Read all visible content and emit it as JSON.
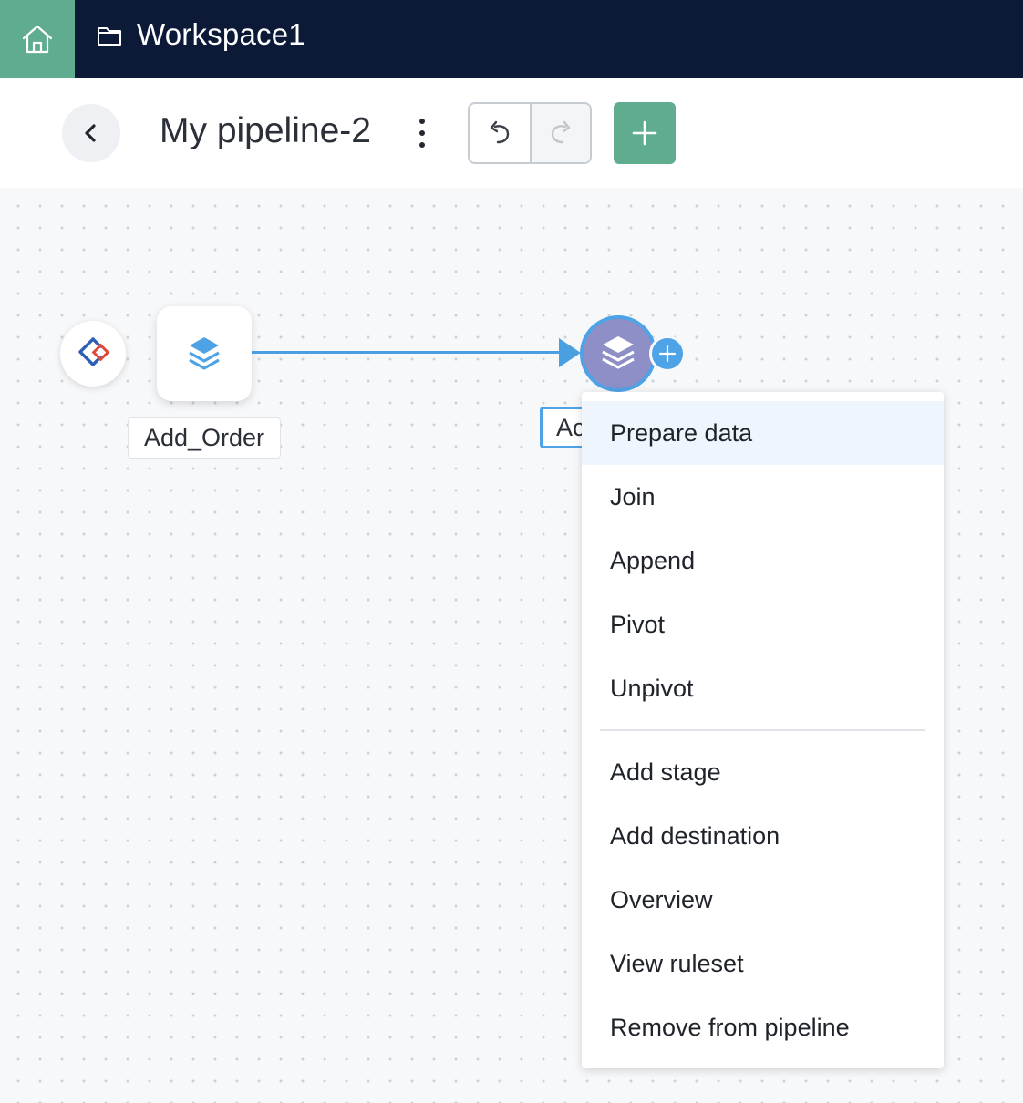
{
  "topbar": {
    "workspace_title": "Workspace1",
    "home_icon": "home-icon",
    "folder_icon": "folder-icon"
  },
  "header": {
    "pipeline_title": "My pipeline-2",
    "back_icon": "chevron-left-icon",
    "more_icon": "kebab-icon",
    "undo_icon": "undo-icon",
    "redo_icon": "redo-icon",
    "add_icon": "plus-icon"
  },
  "canvas": {
    "source_node_icon": "source-connector-icon",
    "order_node_label": "Add_Order",
    "stage_node_label": "Ac",
    "stage_icon": "layers-icon"
  },
  "menu": {
    "items": [
      {
        "label": "Prepare data"
      },
      {
        "label": "Join"
      },
      {
        "label": "Append"
      },
      {
        "label": "Pivot"
      },
      {
        "label": "Unpivot"
      }
    ],
    "items2": [
      {
        "label": "Add stage"
      },
      {
        "label": "Add destination"
      },
      {
        "label": "Overview"
      },
      {
        "label": "View ruleset"
      },
      {
        "label": "Remove from pipeline"
      }
    ]
  },
  "colors": {
    "topbar_bg": "#0c1a38",
    "accent_green": "#5fad8e",
    "accent_blue": "#4ea3e6",
    "stage_purple": "#8e8fc6"
  }
}
